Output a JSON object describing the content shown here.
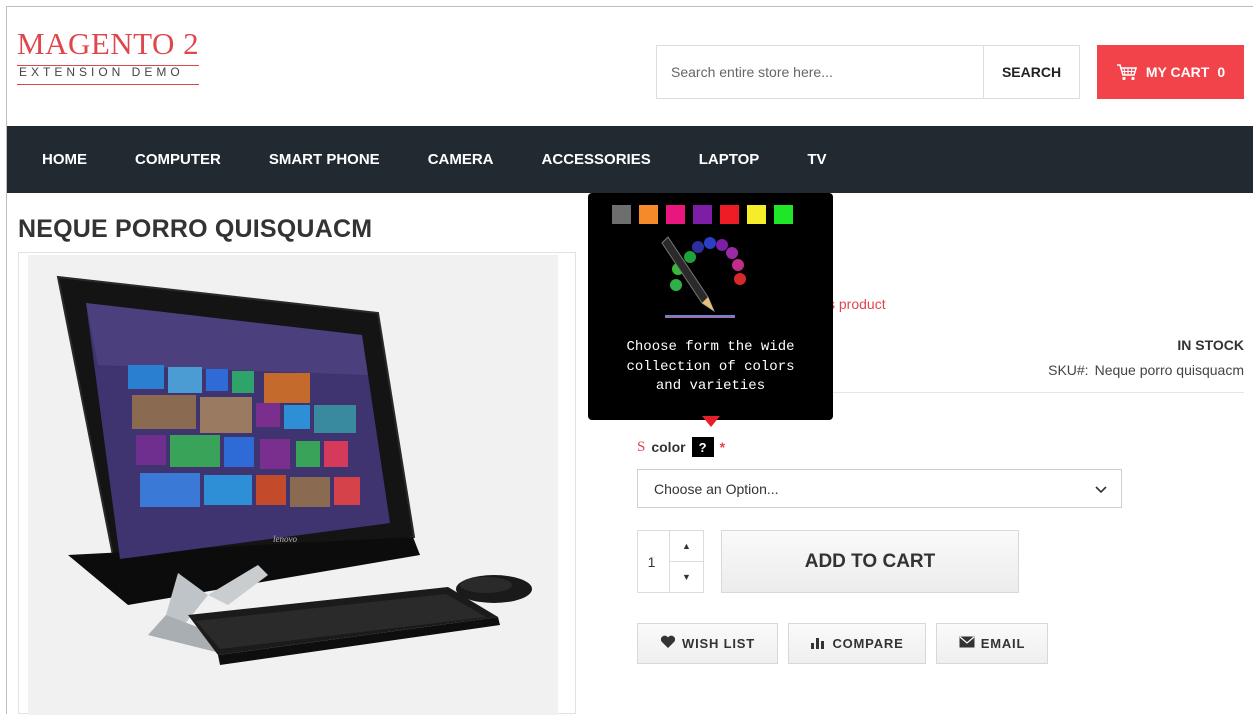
{
  "header": {
    "logo_title": "MAGENTO 2",
    "logo_subtitle": "EXTENSION DEMO",
    "search_placeholder": "Search entire store here...",
    "search_button": "SEARCH",
    "cart_label": "MY CART",
    "cart_count": "0",
    "cart_icon": "shopping-cart-icon"
  },
  "nav": {
    "items": [
      "HOME",
      "COMPUTER",
      "SMART PHONE",
      "CAMERA",
      "ACCESSORIES",
      "LAPTOP",
      "TV"
    ]
  },
  "product": {
    "title": "NEQUE PORRO QUISQUACM",
    "review_link": "s product",
    "stock": "IN STOCK",
    "sku_label": "SKU#:",
    "sku_value": "Neque porro quisquacm",
    "option_prefix": "S",
    "option_label": "color",
    "help_label": "?",
    "required_mark": "*",
    "select_value": "Choose an Option...",
    "qty": "1",
    "add_to_cart": "ADD TO CART",
    "actions": {
      "wishlist": "WISH LIST",
      "compare": "COMPARE",
      "email": "EMAIL"
    }
  },
  "tooltip": {
    "swatch_colors": [
      "#6e6e6e",
      "#f58a2a",
      "#e8167d",
      "#7d1ea6",
      "#ee1c24",
      "#f7ec2a",
      "#1fe627"
    ],
    "text_lines": [
      "Choose form the wide",
      "collection of colors",
      "and varieties"
    ]
  },
  "colors": {
    "accent": "#f2434b",
    "nav_bg": "#222a31",
    "logo": "#e0474d"
  }
}
